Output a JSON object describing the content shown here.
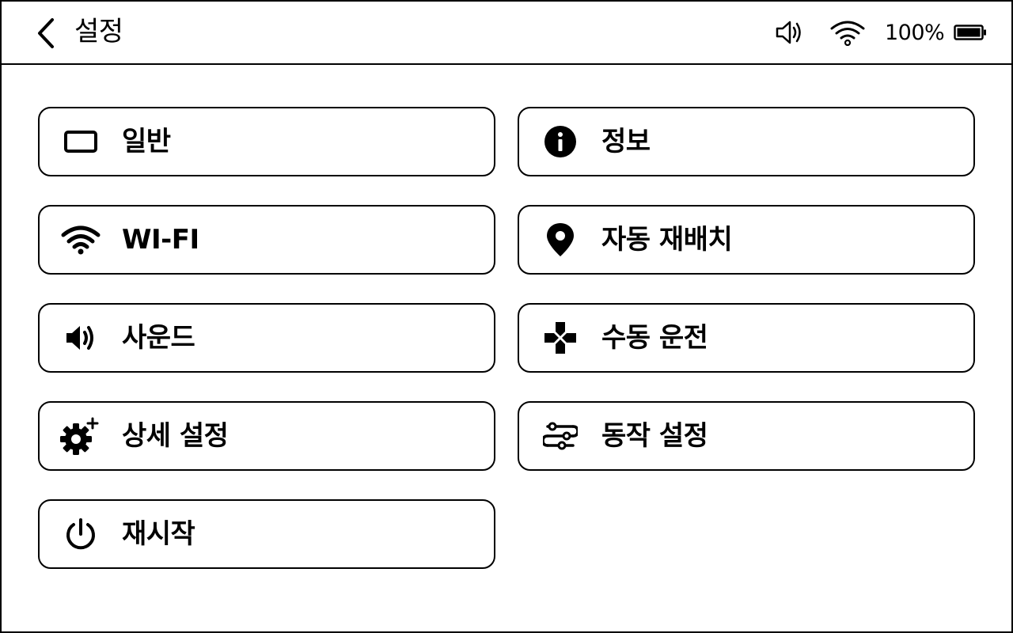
{
  "header": {
    "title": "설정",
    "back_icon": "chevron-left-icon",
    "status": {
      "volume_icon": "speaker-icon",
      "wifi_icon": "wifi-icon",
      "battery_text": "100%",
      "battery_level": 1.0
    }
  },
  "menu": {
    "items": [
      {
        "label": "일반",
        "icon": "rectangle-icon"
      },
      {
        "label": "정보",
        "icon": "info-icon"
      },
      {
        "label": "WI-FI",
        "icon": "wifi-icon"
      },
      {
        "label": "자동 재배치",
        "icon": "location-pin-icon"
      },
      {
        "label": "사운드",
        "icon": "speaker-icon"
      },
      {
        "label": "수동 운전",
        "icon": "gamepad-icon"
      },
      {
        "label": "상세 설정",
        "icon": "gear-plus-icon"
      },
      {
        "label": "동작 설정",
        "icon": "sliders-icon"
      },
      {
        "label": "재시작",
        "icon": "power-icon"
      }
    ]
  },
  "colors": {
    "foreground": "#000000",
    "background": "#ffffff"
  }
}
